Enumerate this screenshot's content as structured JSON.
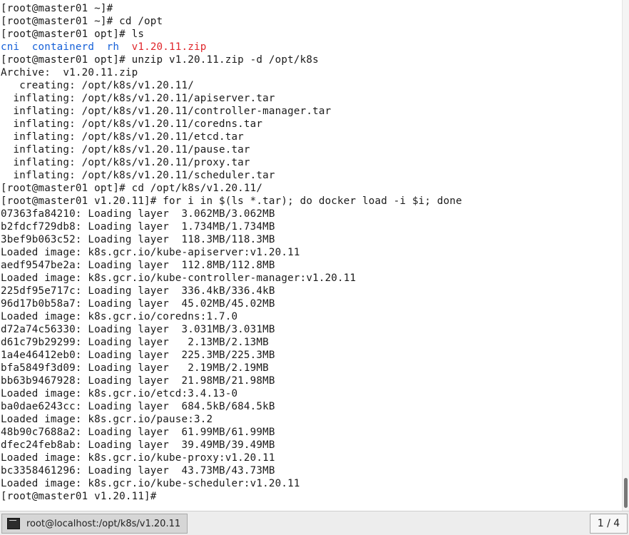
{
  "terminal": {
    "lines": [
      "[root@master01 ~]# ",
      "[root@master01 ~]# cd /opt",
      "[root@master01 opt]# ls",
      "",
      "[root@master01 opt]# unzip v1.20.11.zip -d /opt/k8s",
      "Archive:  v1.20.11.zip",
      "   creating: /opt/k8s/v1.20.11/",
      "  inflating: /opt/k8s/v1.20.11/apiserver.tar",
      "  inflating: /opt/k8s/v1.20.11/controller-manager.tar",
      "  inflating: /opt/k8s/v1.20.11/coredns.tar",
      "  inflating: /opt/k8s/v1.20.11/etcd.tar",
      "  inflating: /opt/k8s/v1.20.11/pause.tar",
      "  inflating: /opt/k8s/v1.20.11/proxy.tar",
      "  inflating: /opt/k8s/v1.20.11/scheduler.tar",
      "[root@master01 opt]# cd /opt/k8s/v1.20.11/",
      "[root@master01 v1.20.11]# for i in $(ls *.tar); do docker load -i $i; done",
      "07363fa84210: Loading layer  3.062MB/3.062MB",
      "b2fdcf729db8: Loading layer  1.734MB/1.734MB",
      "3bef9b063c52: Loading layer  118.3MB/118.3MB",
      "Loaded image: k8s.gcr.io/kube-apiserver:v1.20.11",
      "aedf9547be2a: Loading layer  112.8MB/112.8MB",
      "Loaded image: k8s.gcr.io/kube-controller-manager:v1.20.11",
      "225df95e717c: Loading layer  336.4kB/336.4kB",
      "96d17b0b58a7: Loading layer  45.02MB/45.02MB",
      "Loaded image: k8s.gcr.io/coredns:1.7.0",
      "d72a74c56330: Loading layer  3.031MB/3.031MB",
      "d61c79b29299: Loading layer   2.13MB/2.13MB",
      "1a4e46412eb0: Loading layer  225.3MB/225.3MB",
      "bfa5849f3d09: Loading layer   2.19MB/2.19MB",
      "bb63b9467928: Loading layer  21.98MB/21.98MB",
      "Loaded image: k8s.gcr.io/etcd:3.4.13-0",
      "ba0dae6243cc: Loading layer  684.5kB/684.5kB",
      "Loaded image: k8s.gcr.io/pause:3.2",
      "48b90c7688a2: Loading layer  61.99MB/61.99MB",
      "dfec24feb8ab: Loading layer  39.49MB/39.49MB",
      "Loaded image: k8s.gcr.io/kube-proxy:v1.20.11",
      "bc3358461296: Loading layer  43.73MB/43.73MB",
      "Loaded image: k8s.gcr.io/kube-scheduler:v1.20.11",
      "[root@master01 v1.20.11]# "
    ],
    "ls_output": {
      "dir_cni": "cni",
      "sep1": "  ",
      "dir_containerd": "containerd",
      "sep2": "  ",
      "dir_rh": "rh",
      "sep3": "  ",
      "file_zip": "v1.20.11.zip"
    },
    "colors": {
      "directory": "#1560d8",
      "archive": "#e0262b",
      "text": "#1a1a1a"
    }
  },
  "taskbar": {
    "window_title": "root@localhost:/opt/k8s/v1.20.11",
    "window_icon": "terminal-icon",
    "workspace": "1 / 4"
  }
}
